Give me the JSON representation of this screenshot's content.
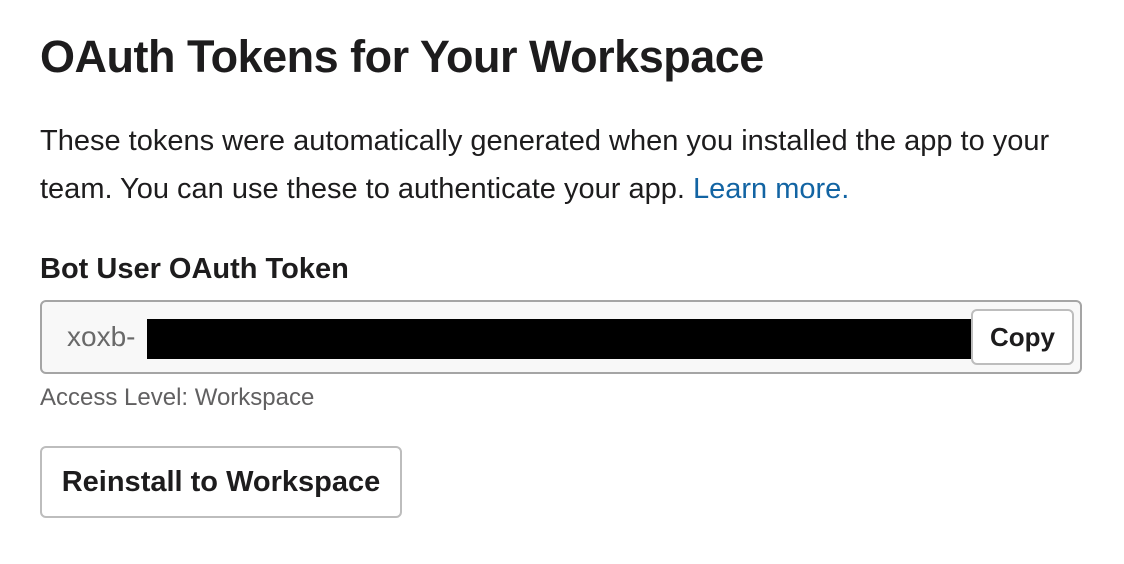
{
  "page": {
    "title": "OAuth Tokens for Your Workspace",
    "description": "These tokens were automatically generated when you installed the app to your team. You can use these to authenticate your app.",
    "learn_more_link": "Learn more."
  },
  "bot_token": {
    "label": "Bot User OAuth Token",
    "value_prefix": "xoxb-",
    "value_redacted": true,
    "copy_label": "Copy",
    "access_level": "Access Level: Workspace"
  },
  "actions": {
    "reinstall_label": "Reinstall to Workspace"
  },
  "colors": {
    "text": "#1d1c1d",
    "link": "#1264a3",
    "muted": "#616061",
    "border": "#a5a5a5",
    "redaction": "#000000"
  }
}
